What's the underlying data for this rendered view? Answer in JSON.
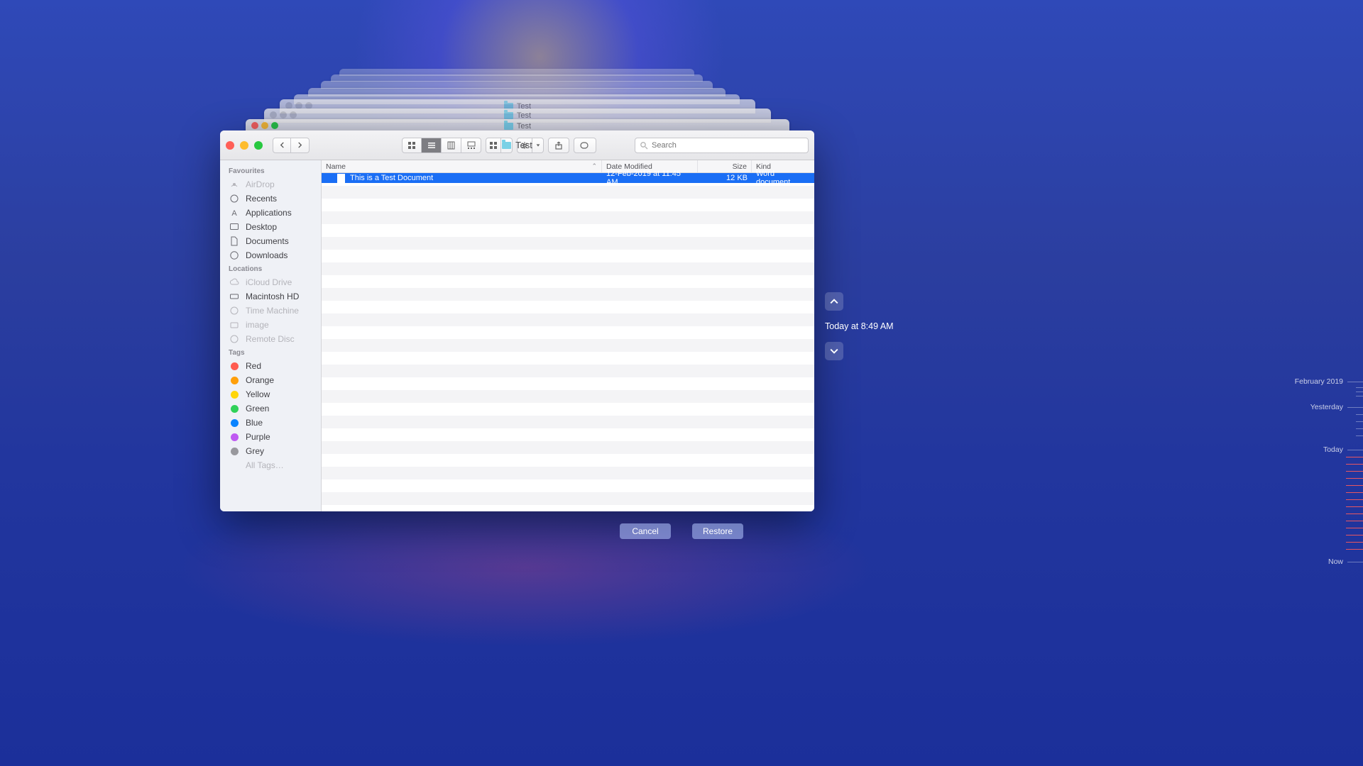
{
  "window": {
    "title": "Test"
  },
  "stack_titles": [
    "Test",
    "Test",
    "Test"
  ],
  "search": {
    "placeholder": "Search"
  },
  "sidebar": {
    "sections": [
      {
        "header": "Favourites",
        "items": [
          {
            "label": "AirDrop",
            "dim": true
          },
          {
            "label": "Recents"
          },
          {
            "label": "Applications"
          },
          {
            "label": "Desktop"
          },
          {
            "label": "Documents"
          },
          {
            "label": "Downloads"
          }
        ]
      },
      {
        "header": "Locations",
        "items": [
          {
            "label": "iCloud Drive",
            "dim": true
          },
          {
            "label": "Macintosh HD"
          },
          {
            "label": "Time Machine",
            "dim": true
          },
          {
            "label": "image",
            "dim": true
          },
          {
            "label": "Remote Disc",
            "dim": true
          }
        ]
      },
      {
        "header": "Tags",
        "items": [
          {
            "label": "Red",
            "color": "#ff5b50"
          },
          {
            "label": "Orange",
            "color": "#ff9f0a"
          },
          {
            "label": "Yellow",
            "color": "#ffd60a"
          },
          {
            "label": "Green",
            "color": "#30d158"
          },
          {
            "label": "Blue",
            "color": "#0a84ff"
          },
          {
            "label": "Purple",
            "color": "#bf5af2"
          },
          {
            "label": "Grey",
            "color": "#98989d"
          },
          {
            "label": "All Tags…",
            "dim": true
          }
        ]
      }
    ]
  },
  "columns": {
    "name": "Name",
    "date": "Date Modified",
    "size": "Size",
    "kind": "Kind"
  },
  "rows": [
    {
      "name": "This is a Test Document",
      "date": "12-Feb-2019 at 11:45 AM",
      "size": "12 KB",
      "kind": "Word document",
      "selected": true
    }
  ],
  "actions": {
    "cancel": "Cancel",
    "restore": "Restore"
  },
  "timeline": {
    "current": "Today at 8:49 AM",
    "labels": [
      "February 2019",
      "Yesterday",
      "Today",
      "Now"
    ]
  }
}
